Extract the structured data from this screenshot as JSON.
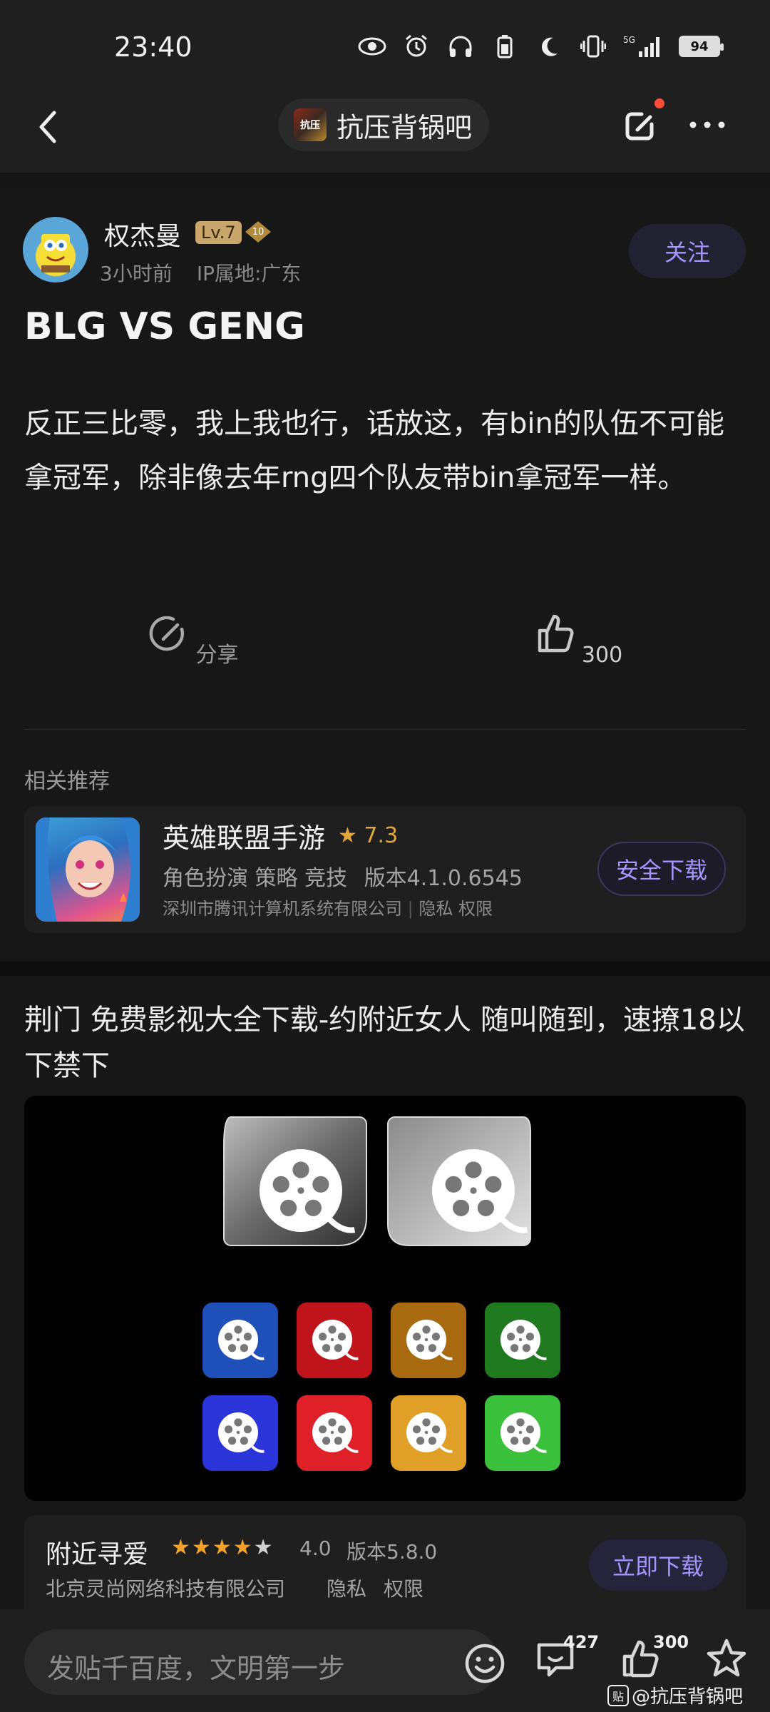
{
  "status_bar": {
    "time": "23:40",
    "battery": "94",
    "icons": [
      "eye-icon",
      "alarm-icon",
      "headphone-icon",
      "battery-saver-icon",
      "moon-icon",
      "vibrate-icon",
      "5g-signal-icon"
    ]
  },
  "nav": {
    "forum_name": "抗压背锅吧",
    "forum_avatar_text": "抗压"
  },
  "post": {
    "author": "权杰曼",
    "level": "Lv.7",
    "medal": "10",
    "time_ago": "3小时前",
    "ip_location": "IP属地:广东",
    "follow_label": "关注",
    "title": "BLG VS GENG",
    "body": "反正三比零，我上我也行，话放这，有bin的队伍不可能拿冠军，除非像去年rng四个队友带bin拿冠军一样。",
    "share_label": "分享",
    "like_count": "300"
  },
  "related": {
    "label": "相关推荐",
    "app": {
      "name": "英雄联盟手游",
      "rating": "7.3",
      "tags": "角色扮演 策略 竞技",
      "version": "版本4.1.0.6545",
      "company": "深圳市腾讯计算机系统有限公司",
      "privacy": "隐私",
      "permissions": "权限",
      "download_label": "安全下载"
    }
  },
  "ad": {
    "text": "荆门 免费影视大全下载-约附近女人 随叫随到，速撩18以下禁下",
    "app_name": "附近寻爱",
    "rating": "4.0",
    "rating_value": 4.0,
    "version": "版本5.8.0",
    "company": "北京灵尚网络科技有限公司",
    "privacy": "隐私",
    "permissions": "权限",
    "download_label": "立即下载",
    "icon_colors": [
      "#1f4fb8",
      "#c0141c",
      "#d59a1c",
      "#2a9a2a"
    ]
  },
  "bottom_bar": {
    "placeholder": "发贴千百度，文明第一步",
    "comment_count": "427",
    "like_count": "300",
    "watermark": "@抗压背锅吧",
    "watermark_box": "贴"
  },
  "colors": {
    "accent": "#a596ff",
    "background": "#171717",
    "notify_dot": "#ff4c39"
  }
}
